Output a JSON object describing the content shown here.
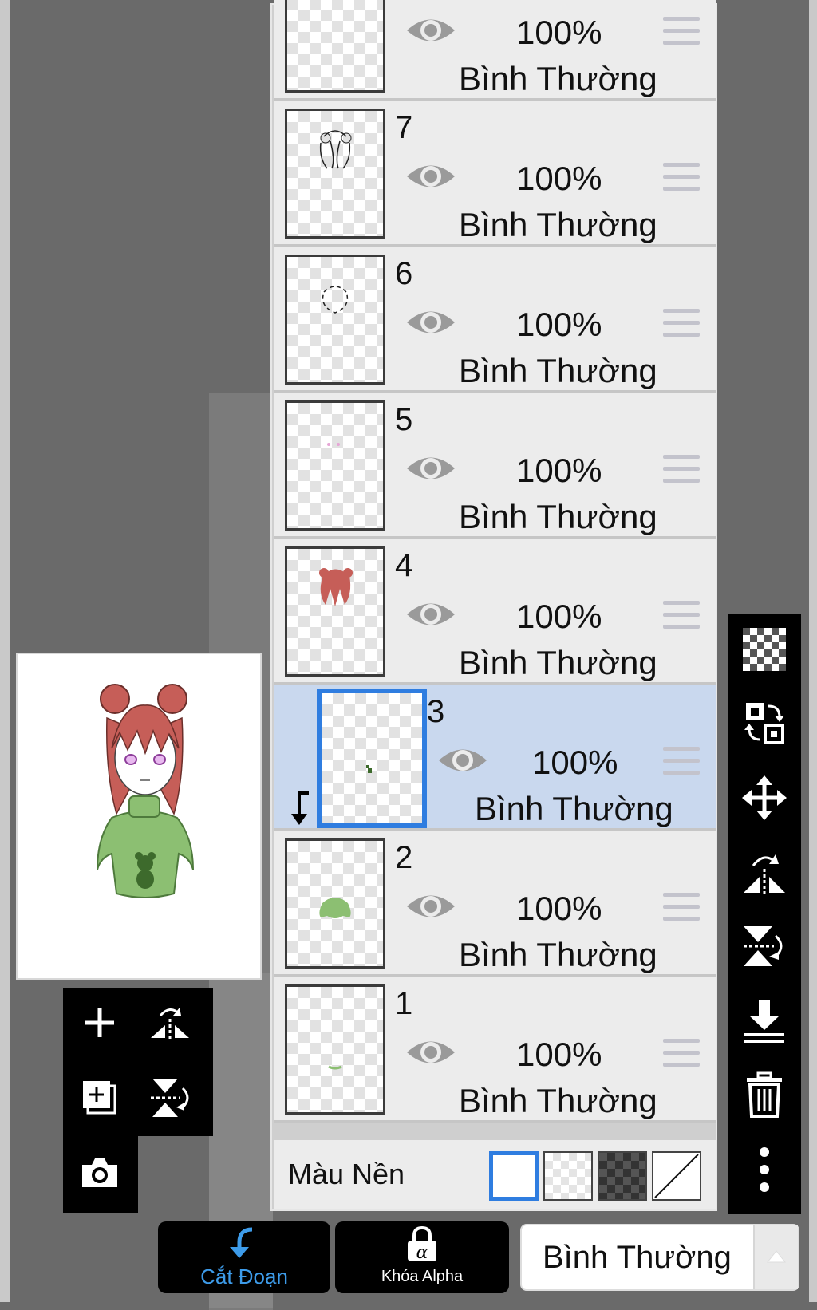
{
  "layers": [
    {
      "number": "",
      "opacity": "100%",
      "blend": "Bình Thường"
    },
    {
      "number": "7",
      "opacity": "100%",
      "blend": "Bình Thường"
    },
    {
      "number": "6",
      "opacity": "100%",
      "blend": "Bình Thường"
    },
    {
      "number": "5",
      "opacity": "100%",
      "blend": "Bình Thường"
    },
    {
      "number": "4",
      "opacity": "100%",
      "blend": "Bình Thường"
    },
    {
      "number": "3",
      "opacity": "100%",
      "blend": "Bình Thường",
      "selected": true
    },
    {
      "number": "2",
      "opacity": "100%",
      "blend": "Bình Thường"
    },
    {
      "number": "1",
      "opacity": "100%",
      "blend": "Bình Thường"
    }
  ],
  "background": {
    "label": "Màu Nền",
    "options": [
      "white",
      "transparent-light",
      "transparent-dark",
      "none"
    ],
    "selected": "white"
  },
  "bottom_bar": {
    "clipping_label": "Cắt Đoạn",
    "alpha_lock_label": "Khóa Alpha",
    "blend_mode": "Bình Thường"
  },
  "right_toolbar": [
    "transparency-icon",
    "swap-layers-icon",
    "move-icon",
    "flip-horizontal-icon",
    "flip-vertical-icon",
    "merge-down-icon",
    "trash-icon",
    "more-icon"
  ],
  "left_toolbar": [
    "add-layer-icon",
    "flip-horizontal-icon",
    "duplicate-layer-icon",
    "flip-vertical-icon",
    "camera-icon"
  ],
  "colors": {
    "accent": "#2f7de0",
    "clip_label": "#3d9be9",
    "selected_layer": "#c9d8ee"
  }
}
